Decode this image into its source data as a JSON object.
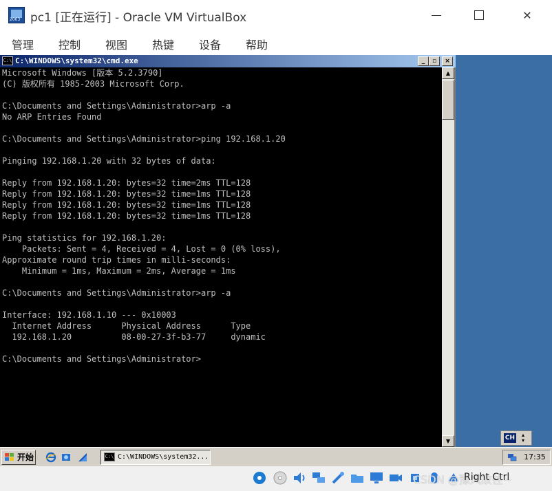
{
  "host": {
    "title": "pc1 [正在运行] - Oracle VM VirtualBox",
    "icon_label": "2003",
    "menu": [
      "管理",
      "控制",
      "视图",
      "热键",
      "设备",
      "帮助"
    ],
    "controls": {
      "minimize": "—",
      "maximize": "☐",
      "close": "✕"
    },
    "status": {
      "host_key": "Right Ctrl",
      "watermark": "CSDN @豫风故往~"
    }
  },
  "cmd": {
    "title": "C:\\WINDOWS\\system32\\cmd.exe",
    "icon_label": "C:\\",
    "lines": [
      "Microsoft Windows [版本 5.2.3790]",
      "(C) 版权所有 1985-2003 Microsoft Corp.",
      "",
      "C:\\Documents and Settings\\Administrator>arp -a",
      "No ARP Entries Found",
      "",
      "C:\\Documents and Settings\\Administrator>ping 192.168.1.20",
      "",
      "Pinging 192.168.1.20 with 32 bytes of data:",
      "",
      "Reply from 192.168.1.20: bytes=32 time=2ms TTL=128",
      "Reply from 192.168.1.20: bytes=32 time=1ms TTL=128",
      "Reply from 192.168.1.20: bytes=32 time=1ms TTL=128",
      "Reply from 192.168.1.20: bytes=32 time=1ms TTL=128",
      "",
      "Ping statistics for 192.168.1.20:",
      "    Packets: Sent = 4, Received = 4, Lost = 0 (0% loss),",
      "Approximate round trip times in milli-seconds:",
      "    Minimum = 1ms, Maximum = 2ms, Average = 1ms",
      "",
      "C:\\Documents and Settings\\Administrator>arp -a",
      "",
      "Interface: 192.168.1.10 --- 0x10003",
      "  Internet Address      Physical Address      Type",
      "  192.168.1.20          08-00-27-3f-b3-77     dynamic",
      "",
      "C:\\Documents and Settings\\Administrator>"
    ]
  },
  "guest_taskbar": {
    "start_label": "开始",
    "task_button_label": "C:\\WINDOWS\\system32...",
    "task_button_icon_label": "C:\\",
    "clock": "17:35",
    "language": "CH"
  }
}
